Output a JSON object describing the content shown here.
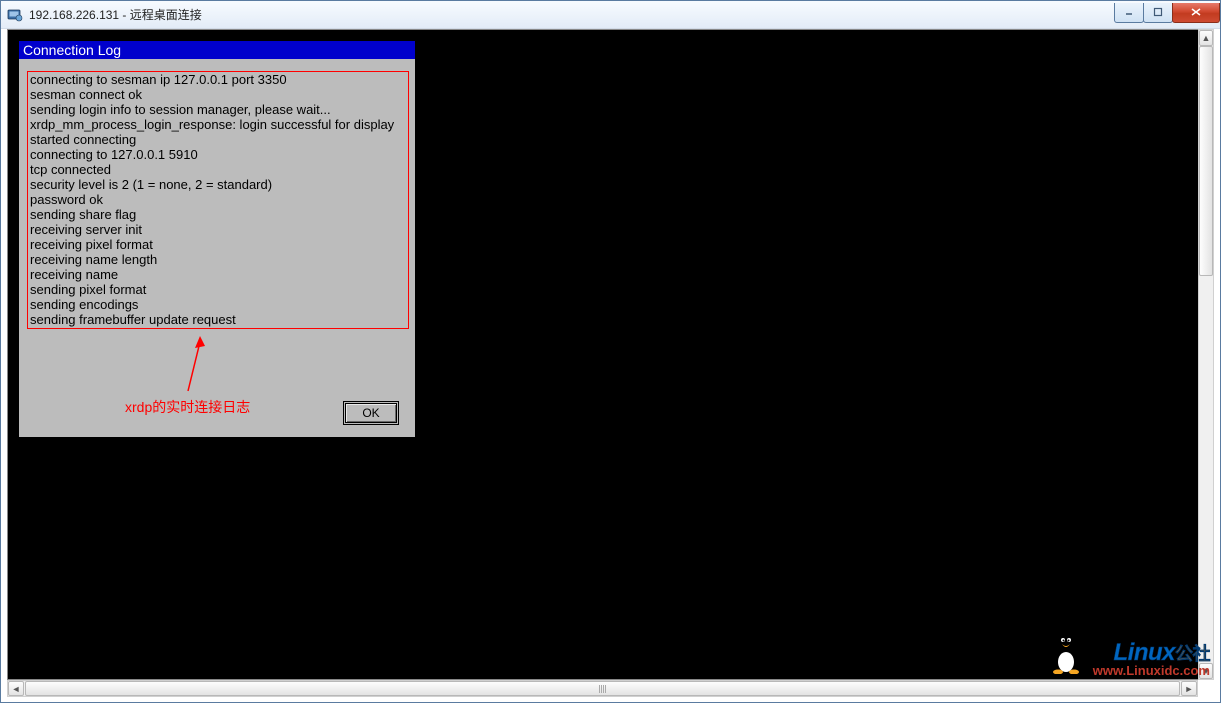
{
  "window": {
    "title": "192.168.226.131 - 远程桌面连接"
  },
  "dialog": {
    "title": "Connection Log",
    "log_lines": [
      "connecting to sesman ip 127.0.0.1 port 3350",
      "sesman connect ok",
      "sending login info to session manager, please wait...",
      "xrdp_mm_process_login_response: login successful for display",
      "started connecting",
      "connecting to 127.0.0.1 5910",
      "tcp connected",
      "security level is 2 (1 = none, 2 = standard)",
      "password ok",
      "sending share flag",
      "receiving server init",
      "receiving pixel format",
      "receiving name length",
      "receiving name",
      "sending pixel format",
      "sending encodings",
      "sending framebuffer update request"
    ],
    "ok_label": "OK"
  },
  "annotation": {
    "text": "xrdp的实时连接日志"
  },
  "watermark": {
    "brand": "Linux",
    "suffix": "公社",
    "url": "www.Linuxidc.com"
  }
}
